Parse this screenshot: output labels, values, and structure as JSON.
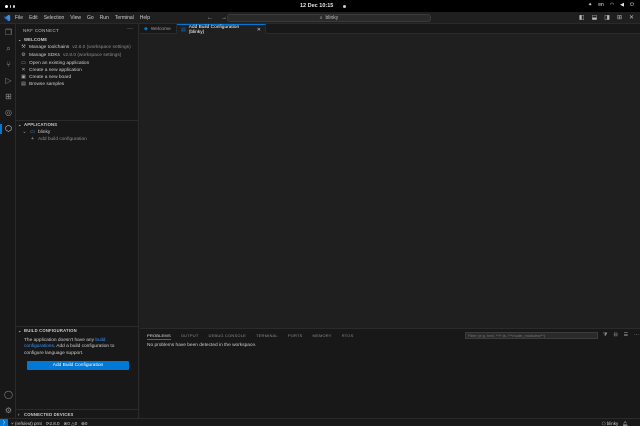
{
  "gnome": {
    "clock": "12 Dec  10:15",
    "lang": "en"
  },
  "titlebar": {
    "menu": [
      "File",
      "Edit",
      "Selection",
      "View",
      "Go",
      "Run",
      "Terminal",
      "Help"
    ],
    "search": "blinky"
  },
  "sidebar": {
    "header": "NRF CONNECT",
    "welcome_title": "WELCOME",
    "welcome_items": [
      {
        "label": "Manage toolchains",
        "detail": "v2.8.0 (workspace settings)"
      },
      {
        "label": "Manage SDKs",
        "detail": "v2.8.0 (workspace settings)"
      },
      {
        "label": "Open an existing application",
        "detail": ""
      },
      {
        "label": "Create a new application",
        "detail": ""
      },
      {
        "label": "Create a new board",
        "detail": ""
      },
      {
        "label": "Browse samples",
        "detail": ""
      }
    ],
    "applications_title": "APPLICATIONS",
    "app_name": "blinky",
    "add_build_config_link": "Add build configuration",
    "build_config_title": "BUILD CONFIGURATION",
    "build_text_pre": "The application doesn't have any ",
    "build_text_link": "build configurations",
    "build_text_post": ". Add a build configuration to configure language support.",
    "add_build_button": "Add Build Configuration",
    "connected_devices_title": "CONNECTED DEVICES"
  },
  "tabs": [
    {
      "label": "Welcome",
      "active": false
    },
    {
      "label": "Add Build Configuration (blinky)",
      "active": true
    }
  ],
  "panel": {
    "tabs": [
      "PROBLEMS",
      "OUTPUT",
      "DEBUG CONSOLE",
      "TERMINAL",
      "PORTS",
      "MEMORY",
      "RTOS"
    ],
    "filter_placeholder": "Filter (e.g. text, **/*.ts, !**/node_modules/**)",
    "message": "No problems have been detected in the workspace."
  },
  "statusbar": {
    "branch": "(refs/ext) prnt",
    "sync": "2.8.0",
    "errors": "0",
    "warnings": "0",
    "ports": "0",
    "app": "blinky"
  },
  "colors": {
    "accent": "#0078d4",
    "link": "#3794ff"
  }
}
